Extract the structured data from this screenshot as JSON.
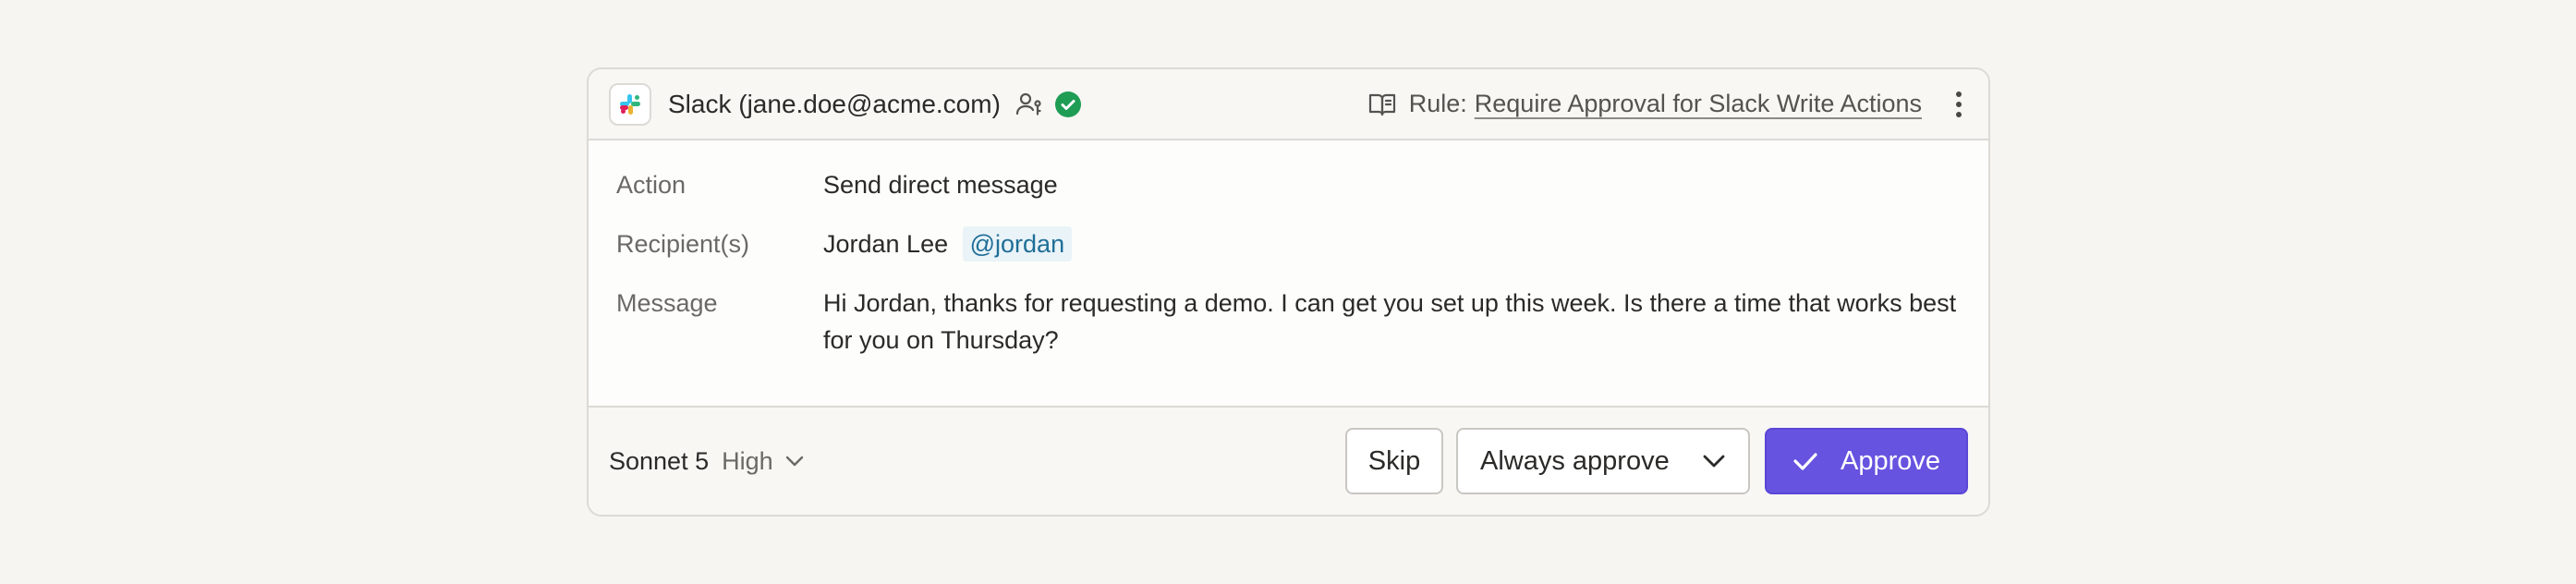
{
  "header": {
    "app_icon": "slack-logo-icon",
    "title": "Slack (jane.doe@acme.com)",
    "person_icon": "user-key-icon",
    "status_icon": "verified-check-icon",
    "status_color": "#1f9d55",
    "rule_icon": "book-open-icon",
    "rule_prefix": "Rule:",
    "rule_name": "Require Approval for Slack Write Actions",
    "menu_icon": "more-vertical-icon"
  },
  "details": {
    "action_label": "Action",
    "action_value": "Send direct message",
    "recipients_label": "Recipient(s)",
    "recipient_name": "Jordan Lee",
    "recipient_handle": "@jordan",
    "message_label": "Message",
    "message_value": "Hi Jordan, thanks for requesting a demo. I can get you set up this week. Is there a time that works best for you on Thursday?"
  },
  "footer": {
    "model_name": "Sonnet 5",
    "model_level": "High",
    "skip_label": "Skip",
    "always_label": "Always approve",
    "approve_label": "Approve",
    "accent_color": "#6653e0"
  }
}
